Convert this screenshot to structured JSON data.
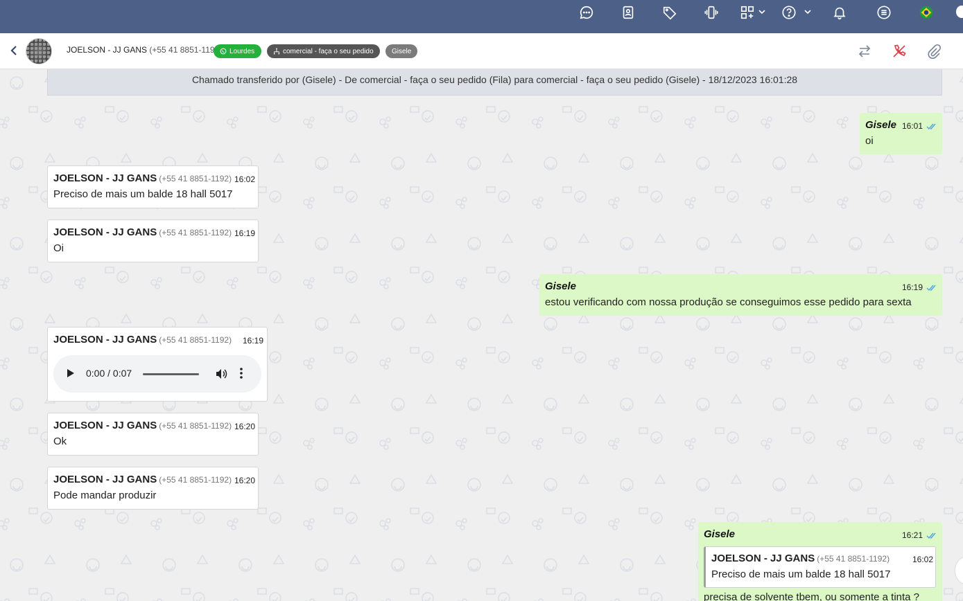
{
  "colors": {
    "topbar": "#4d6188",
    "incoming_bubble": "#ffffff",
    "outgoing_bubble": "#dcf8c6",
    "tag_whatsapp": "#25b03c",
    "tag_queue": "#555555",
    "tag_agent": "#7b7b7b",
    "read_check": "#4fa3e0",
    "call_end": "#e0404a"
  },
  "topbar": {
    "icons": [
      "chat-bubbles-icon",
      "contact-book-icon",
      "tag-icon",
      "vibrate-phone-icon",
      "apps-grid-icon",
      "help-circle-icon",
      "bell-icon",
      "menu-lines-icon",
      "brazil-flag-icon"
    ]
  },
  "header": {
    "contact_name": "JOELSON - JJ GANS",
    "contact_phone": "(+55 41 8851-1192)",
    "tags": {
      "whatsapp": "Lourdes",
      "queue": "comercial - faça o seu pedido",
      "agent": "Gisele"
    },
    "actions": [
      "transfer-arrows-icon",
      "end-call-icon",
      "paperclip-icon"
    ]
  },
  "banner": {
    "text": "Chamado transferido por (Gisele) - De comercial - faça o seu pedido (Fila) para comercial - faça o seu pedido (Gisele) - 18/12/2023 16:01:28"
  },
  "messages": [
    {
      "dir": "out",
      "sender": "Gisele",
      "time": "16:01",
      "text": "oi"
    },
    {
      "dir": "in",
      "sender": "JOELSON - JJ GANS",
      "phone": "(+55 41 8851-1192)",
      "time": "16:02",
      "text": "Preciso de mais um balde 18 hall 5017"
    },
    {
      "dir": "in",
      "sender": "JOELSON - JJ GANS",
      "phone": "(+55 41 8851-1192)",
      "time": "16:19",
      "text": "Oi"
    },
    {
      "dir": "out",
      "sender": "Gisele",
      "time": "16:19",
      "text": "estou verificando com nossa produção se conseguimos esse pedido para sexta"
    },
    {
      "dir": "in",
      "sender": "JOELSON - JJ GANS",
      "phone": "(+55 41 8851-1192)",
      "time": "16:19",
      "audio": {
        "position": "0:00 / 0:07",
        "progress": 0
      }
    },
    {
      "dir": "in",
      "sender": "JOELSON - JJ GANS",
      "phone": "(+55 41 8851-1192)",
      "time": "16:20",
      "text": "Ok"
    },
    {
      "dir": "in",
      "sender": "JOELSON - JJ GANS",
      "phone": "(+55 41 8851-1192)",
      "time": "16:20",
      "text": "Pode mandar produzir"
    },
    {
      "dir": "out",
      "sender": "Gisele",
      "time": "16:21",
      "quote": {
        "sender": "JOELSON - JJ GANS",
        "phone": "(+55 41 8851-1192)",
        "time": "16:02",
        "text": "Preciso de mais um balde 18 hall 5017"
      },
      "text": "precisa de solvente tbem, ou somente a tinta ?"
    }
  ]
}
